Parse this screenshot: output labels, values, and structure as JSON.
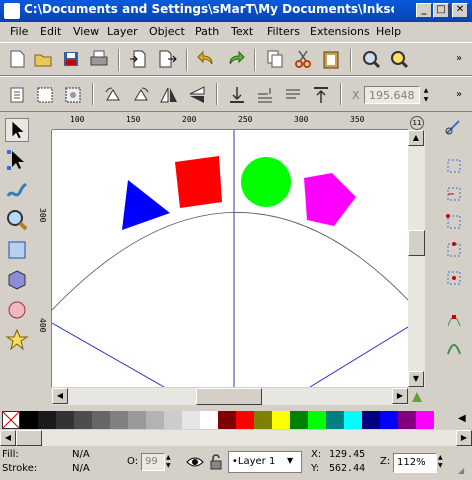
{
  "window": {
    "title": "C:\\Documents and Settings\\sMarT\\My Documents\\Inkscape\\misc\\..."
  },
  "menu": [
    "File",
    "Edit",
    "View",
    "Layer",
    "Object",
    "Path",
    "Text",
    "Filters",
    "Extensions",
    "Help"
  ],
  "toolbar_controls": {
    "x_label": "X",
    "x_value": "195.648"
  },
  "rulers": {
    "horizontal": [
      "100",
      "150",
      "200",
      "250",
      "300",
      "350"
    ],
    "vertical": [
      "300",
      "400"
    ],
    "corner": "11"
  },
  "status": {
    "fill_label": "Fill:",
    "fill_value": "N/A",
    "stroke_label": "Stroke:",
    "stroke_value": "N/A",
    "opacity_label": "O:",
    "opacity_value": "99",
    "layer": "•Layer 1",
    "x_label": "X:",
    "x_value": "129.45",
    "y_label": "Y:",
    "y_value": "562.44",
    "zoom_label": "Z:",
    "zoom_value": "112%"
  },
  "palette": [
    "#000000",
    "#1a1a1a",
    "#333333",
    "#4d4d4d",
    "#666666",
    "#808080",
    "#999999",
    "#b3b3b3",
    "#cccccc",
    "#e6e6e6",
    "#ffffff",
    "#800000",
    "#ff0000",
    "#808000",
    "#ffff00",
    "#008000",
    "#00ff00",
    "#008080",
    "#00ffff",
    "#000080",
    "#0000ff",
    "#800080",
    "#ff00ff"
  ],
  "shapes": {
    "triangle_color": "#0000ff",
    "square_color": "#ff0000",
    "circle_color": "#00ff00",
    "pentagon_color": "#ff00ff",
    "guide_color": "#3333cc"
  }
}
